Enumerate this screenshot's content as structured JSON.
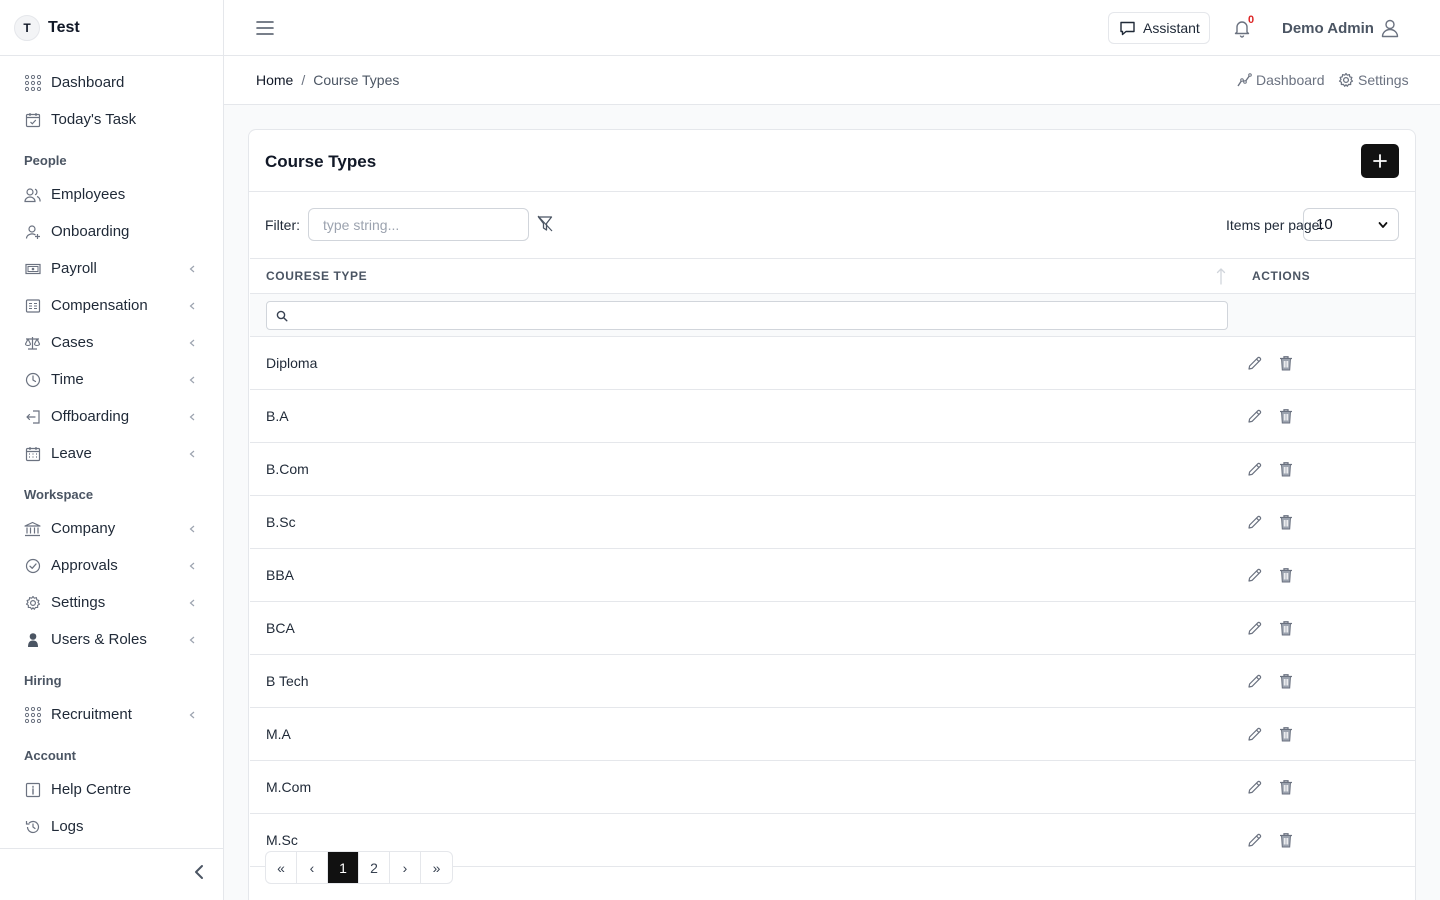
{
  "app": {
    "badge": "T",
    "name": "Test"
  },
  "sidebar": {
    "top_items": [
      {
        "label": "Dashboard",
        "icon": "grid-dots-icon"
      },
      {
        "label": "Today's Task",
        "icon": "calendar-check-icon"
      }
    ],
    "sections": [
      {
        "title": "People",
        "items": [
          {
            "label": "Employees",
            "icon": "users-icon",
            "chevron": false
          },
          {
            "label": "Onboarding",
            "icon": "user-plus-icon",
            "chevron": false
          },
          {
            "label": "Payroll",
            "icon": "money-icon",
            "chevron": true
          },
          {
            "label": "Compensation",
            "icon": "receipt-icon",
            "chevron": true
          },
          {
            "label": "Cases",
            "icon": "scale-icon",
            "chevron": true
          },
          {
            "label": "Time",
            "icon": "clock-icon",
            "chevron": true
          },
          {
            "label": "Offboarding",
            "icon": "logout-icon",
            "chevron": true
          },
          {
            "label": "Leave",
            "icon": "calendar-icon",
            "chevron": true
          }
        ]
      },
      {
        "title": "Workspace",
        "items": [
          {
            "label": "Company",
            "icon": "building-icon",
            "chevron": true
          },
          {
            "label": "Approvals",
            "icon": "check-circle-icon",
            "chevron": true
          },
          {
            "label": "Settings",
            "icon": "gear-icon",
            "chevron": true
          },
          {
            "label": "Users & Roles",
            "icon": "user-shield-icon",
            "chevron": true
          }
        ]
      },
      {
        "title": "Hiring",
        "items": [
          {
            "label": "Recruitment",
            "icon": "grid-dots-icon",
            "chevron": true
          }
        ]
      },
      {
        "title": "Account",
        "items": [
          {
            "label": "Help Centre",
            "icon": "info-icon",
            "chevron": false
          },
          {
            "label": "Logs",
            "icon": "history-icon",
            "chevron": false
          }
        ]
      }
    ]
  },
  "topbar": {
    "assistant_label": "Assistant",
    "notification_count": "0",
    "user_name": "Demo Admin"
  },
  "breadcrumb": {
    "home": "Home",
    "separator": "/",
    "current": "Course Types"
  },
  "quick_links": {
    "dashboard": "Dashboard",
    "settings": "Settings"
  },
  "card": {
    "title": "Course Types"
  },
  "filter": {
    "label": "Filter:",
    "placeholder": "type string..."
  },
  "items_per_page": {
    "label": "Items per page:",
    "value": "10"
  },
  "table": {
    "columns": [
      "COURESE TYPE",
      "ACTIONS"
    ],
    "rows": [
      "Diploma",
      "B.A",
      "B.Com",
      "B.Sc",
      "BBA",
      "BCA",
      "B Tech",
      "M.A",
      "M.Com",
      "M.Sc"
    ]
  },
  "pagination": {
    "first": "«",
    "prev": "‹",
    "pages": [
      "1",
      "2"
    ],
    "active_page": "1",
    "next": "›",
    "last": "»"
  }
}
